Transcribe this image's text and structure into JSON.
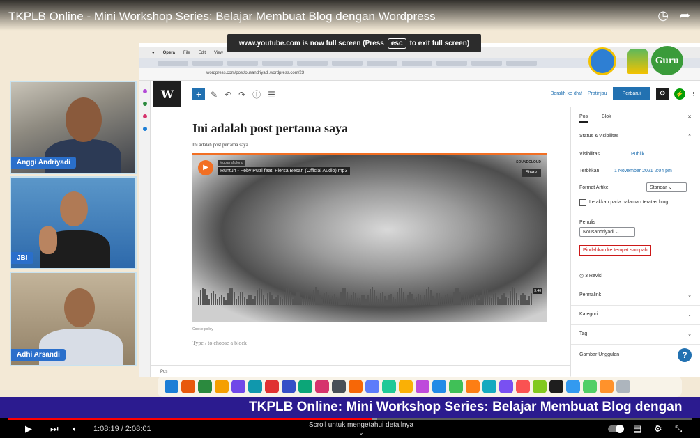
{
  "video": {
    "title": "TKPLB Online - Mini Workshop Series: Belajar Membuat Blog dengan Wordpress",
    "fullscreen_notice_before": "www.youtube.com is now full screen (Press",
    "fullscreen_notice_key": "esc",
    "fullscreen_notice_after": "to exit full screen)",
    "time": "1:08:19 / 2:08:01",
    "scroll_hint": "Scroll untuk mengetahui detailnya",
    "progress": 0.533,
    "buffered": 0.54
  },
  "participants": [
    {
      "name": "Anggi Andriyadi"
    },
    {
      "name": "JBI"
    },
    {
      "name": "Adhi Arsandi"
    }
  ],
  "logos": {
    "guru": "Guru"
  },
  "banner": {
    "text": "TKPLB Online: Mini Workshop Series: Belajar Membuat Blog dengan"
  },
  "browser": {
    "menu_app": "Opera",
    "menu_items": [
      "File",
      "Edit",
      "View"
    ],
    "url": "wordpress.com/post/ousandriyadi.wordpress.com/23"
  },
  "wordpress": {
    "logo": "W",
    "save_draft": "Beralih ke draf",
    "preview": "Pratinjau",
    "publish": "Perbarui",
    "post_title": "Ini adalah post pertama saya",
    "post_paragraph": "Ini adalah post pertama saya",
    "embed": {
      "user": "Mubarraf plong",
      "track": "Runtuh - Feby Putri feat. Fiersa Besari (Official Audio).mp3",
      "brand": "SOUNDCLOUD",
      "share": "Share",
      "duration": "3:46"
    },
    "cookie_policy": "Cookie policy",
    "choose_block": "Type / to choose a block",
    "footer_breadcrumb": "Pos",
    "panel": {
      "tab_post": "Pos",
      "tab_block": "Blok",
      "status_section": "Status & visibilitas",
      "visibility_label": "Visibilitas",
      "visibility_value": "Publik",
      "published_label": "Terbitkan",
      "published_value": "1 November 2021 2:04 pm",
      "format_label": "Format Artikel",
      "format_value": "Standar",
      "sticky_label": "Letakkan pada halaman teratas blog",
      "author_label": "Penulis",
      "author_value": "Nousandriyadi",
      "trash": "Pindahkan ke tempat sampah",
      "revisions": "3 Revisi",
      "permalink": "Permalink",
      "categories": "Kategori",
      "tags": "Tag",
      "featured_image": "Gambar Unggulan"
    }
  },
  "colors": {
    "youtube_red": "#ff0000",
    "banner": "#2b1b8f",
    "wp_blue": "#2271b1",
    "soundcloud": "#f26f23"
  }
}
